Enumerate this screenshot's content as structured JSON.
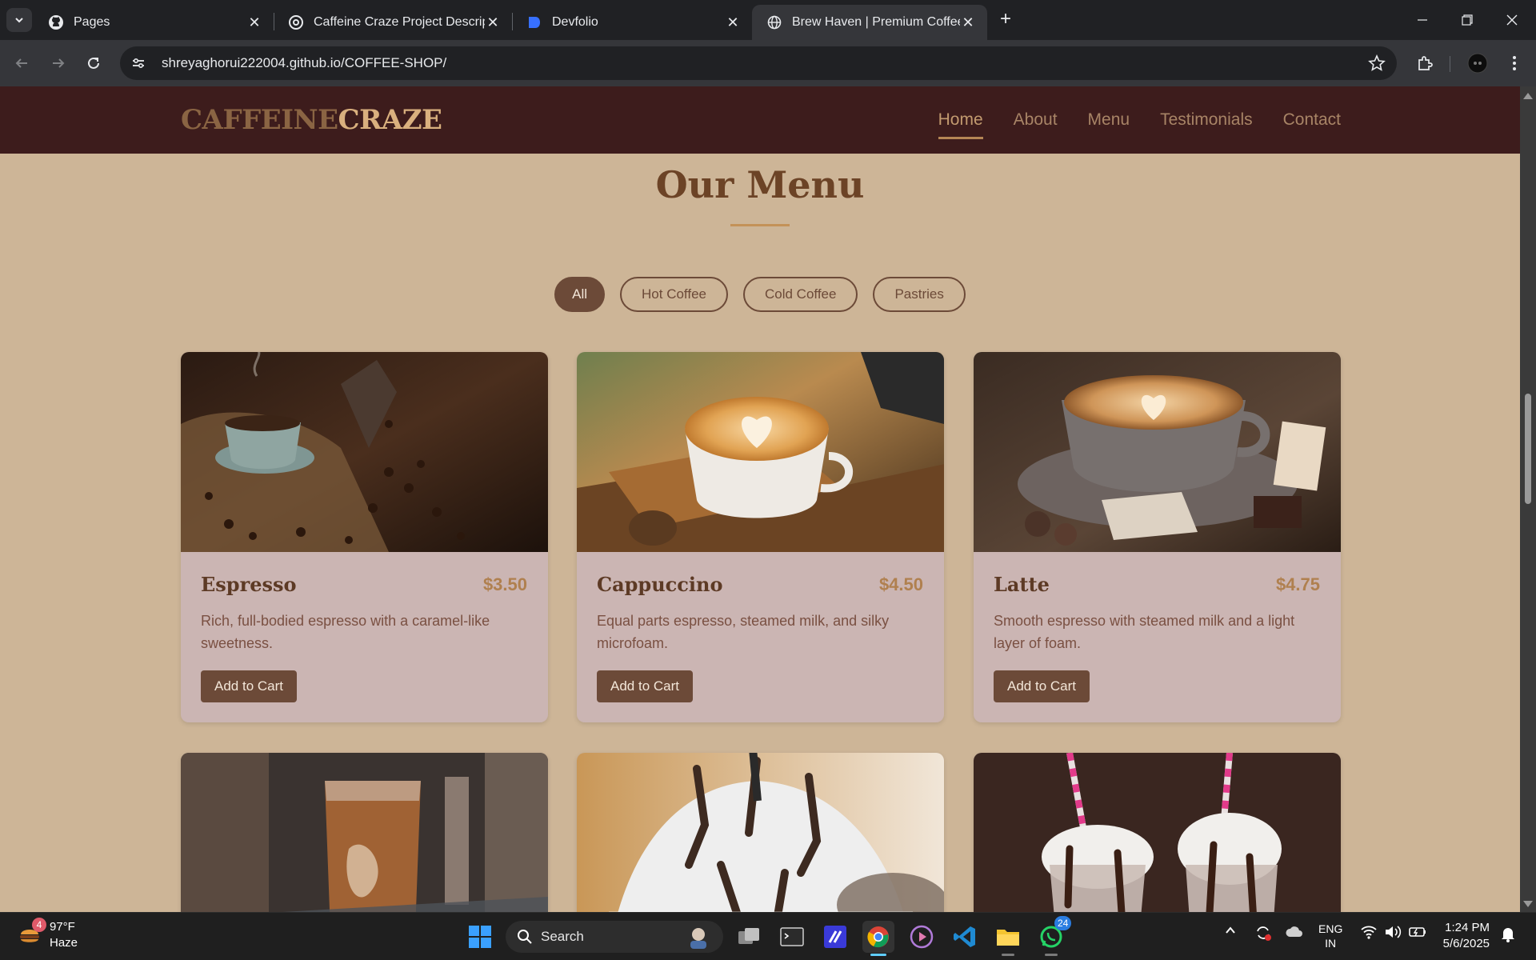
{
  "browser": {
    "tabs": [
      {
        "title": "Pages",
        "icon": "github-icon",
        "active": false
      },
      {
        "title": "Caffeine Craze Project Descripti",
        "icon": "chatgpt-icon",
        "active": false
      },
      {
        "title": "Devfolio",
        "icon": "devfolio-icon",
        "active": false
      },
      {
        "title": "Brew Haven | Premium Coffee E",
        "icon": "globe-icon",
        "active": true
      }
    ],
    "url": "shreyaghorui222004.github.io/COFFEE-SHOP/"
  },
  "site": {
    "logo_part1": "CAFFEINE",
    "logo_part2": "CRAZE",
    "nav": [
      "Home",
      "About",
      "Menu",
      "Testimonials",
      "Contact"
    ],
    "active_nav": "Home"
  },
  "menu": {
    "title": "Our Menu",
    "filters": [
      "All",
      "Hot Coffee",
      "Cold Coffee",
      "Pastries"
    ],
    "active_filter": "All",
    "items": [
      {
        "name": "Espresso",
        "price": "$3.50",
        "description": "Rich, full-bodied espresso with a caramel-like sweetness.",
        "button": "Add to Cart"
      },
      {
        "name": "Cappuccino",
        "price": "$4.50",
        "description": "Equal parts espresso, steamed milk, and silky microfoam.",
        "button": "Add to Cart"
      },
      {
        "name": "Latte",
        "price": "$4.75",
        "description": "Smooth espresso with steamed milk and a light layer of foam.",
        "button": "Add to Cart"
      }
    ]
  },
  "taskbar": {
    "weather_temp": "97°F",
    "weather_desc": "Haze",
    "weather_badge": "4",
    "search_label": "Search",
    "whatsapp_badge": "24",
    "lang": "ENG",
    "region": "IN",
    "time": "1:24 PM",
    "date": "5/6/2025"
  },
  "colors": {
    "page_bg": "#cdb597",
    "header_bg": "#3d1c1c",
    "card_bg": "#cbb5b3",
    "accent_brown": "#6c4a38",
    "price_gold": "#b0804f"
  }
}
